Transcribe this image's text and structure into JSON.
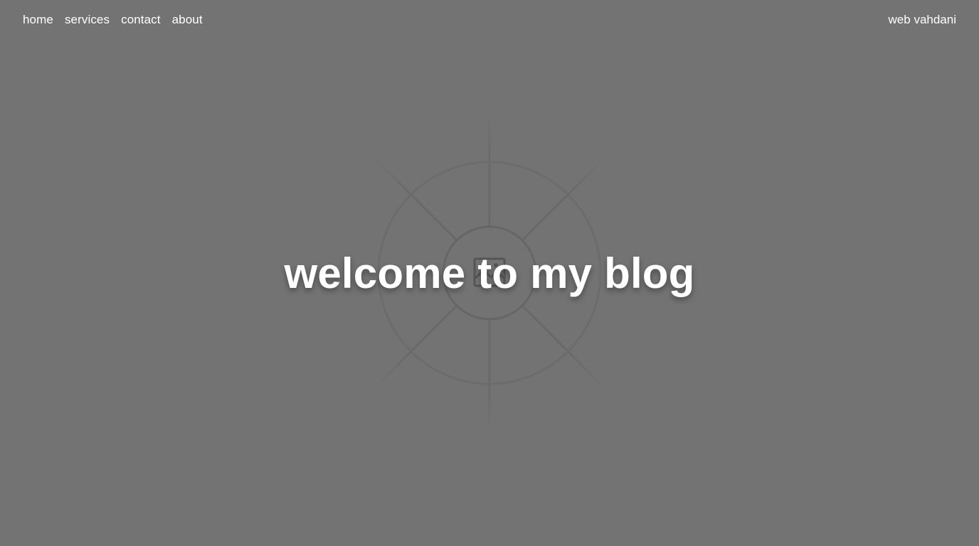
{
  "nav": {
    "links": [
      {
        "label": "home"
      },
      {
        "label": "services"
      },
      {
        "label": "contact"
      },
      {
        "label": "about"
      }
    ],
    "brand": "web vahdani"
  },
  "hero": {
    "title": "welcome to my blog",
    "background_icon": "broken-image-icon"
  },
  "colors": {
    "background": "#737373",
    "text": "#ffffff",
    "graphic_lines": "#6a6a6a"
  }
}
